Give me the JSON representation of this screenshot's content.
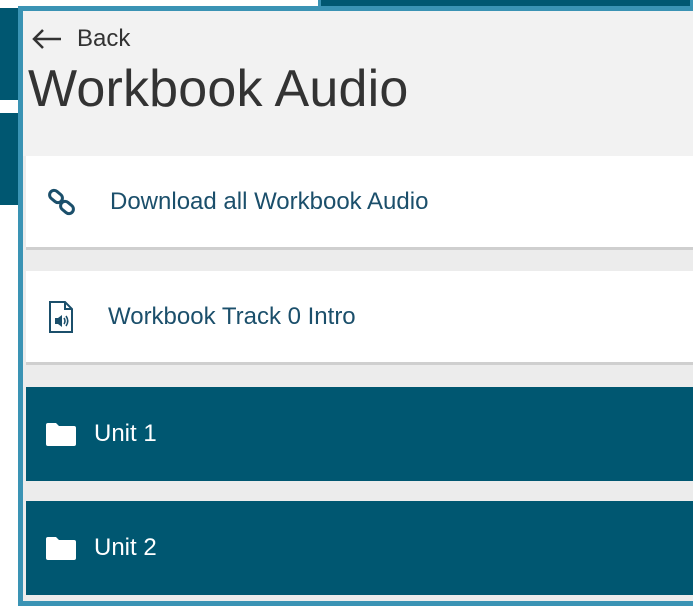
{
  "nav": {
    "back_label": "Back"
  },
  "page": {
    "title": "Workbook Audio"
  },
  "items": [
    {
      "label": "Download all Workbook Audio",
      "icon": "link-icon"
    },
    {
      "label": "Workbook Track 0 Intro",
      "icon": "audio-file-icon"
    },
    {
      "label": "Unit 1",
      "icon": "folder-icon"
    },
    {
      "label": "Unit 2",
      "icon": "folder-icon"
    }
  ],
  "colors": {
    "accent": "#005771",
    "border": "#3a93b4",
    "link_text": "#1b4f6b",
    "header_bg": "#f2f2f2"
  }
}
